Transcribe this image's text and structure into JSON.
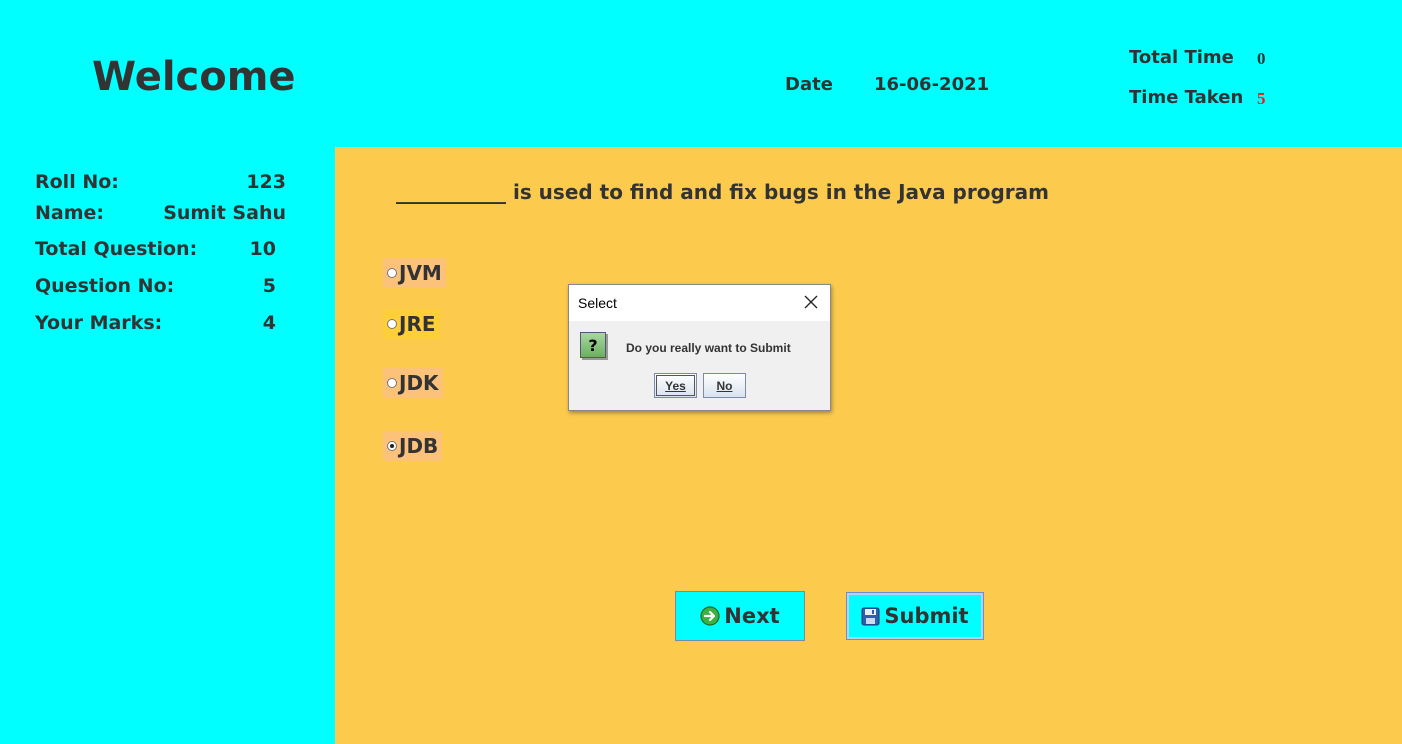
{
  "header": {
    "welcome": "Welcome",
    "date_label": "Date",
    "date_value": "16-06-2021",
    "total_time_label": "Total Time",
    "total_time_value": "0",
    "time_taken_label": "Time Taken",
    "time_taken_value": "5"
  },
  "info": {
    "roll_label": "Roll No:",
    "roll_value": "123",
    "name_label": "Name:",
    "name_value": "Sumit Sahu",
    "total_q_label": "Total Question:",
    "total_q_value": "10",
    "q_no_label": "Question No:",
    "q_no_value": "5",
    "marks_label": "Your Marks:",
    "marks_value": "4"
  },
  "question": {
    "text": "___________ is used to find and fix bugs in the Java program",
    "options": [
      "JVM",
      "JRE",
      "JDK",
      "JDB"
    ],
    "selected": "JDB"
  },
  "buttons": {
    "next": "Next",
    "submit": "Submit"
  },
  "dialog": {
    "title": "Select",
    "message": "Do you really want to Submit",
    "yes": "Yes",
    "no": "No",
    "icon_glyph": "?"
  },
  "colors": {
    "page_bg": "#00ffff",
    "panel_bg": "#fccb4e",
    "option_bg": "#fdc27a",
    "time_taken_color": "#e02020"
  }
}
